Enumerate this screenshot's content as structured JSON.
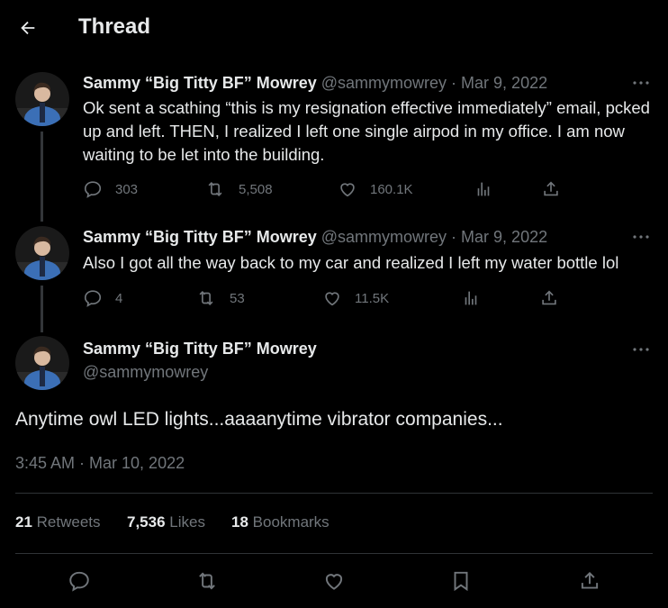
{
  "header": {
    "title": "Thread",
    "back_icon": "back-arrow-icon"
  },
  "tweets": [
    {
      "name": "Sammy “Big Titty BF” Mowrey",
      "handle": "@sammymowrey",
      "separator": "·",
      "date": "Mar 9, 2022",
      "text": "Ok sent a scathing “this is my resignation effective immediately” email, pcked up and left. THEN, I realized I left one single airpod in my office. I am now waiting to be let into the building.",
      "replies": "303",
      "retweets": "5,508",
      "likes": "160.1K"
    },
    {
      "name": "Sammy “Big Titty BF” Mowrey",
      "handle": "@sammymowrey",
      "separator": "·",
      "date": "Mar 9, 2022",
      "text": "Also I got all the way back to my car and realized I left my water bottle lol",
      "replies": "4",
      "retweets": "53",
      "likes": "11.5K"
    }
  ],
  "main_tweet": {
    "name": "Sammy “Big Titty BF” Mowrey",
    "handle": "@sammymowrey",
    "text": "Anytime owl LED lights...aaaanytime vibrator companies...",
    "timestamp": "3:45 AM · Mar 10, 2022",
    "stats": {
      "retweets_count": "21",
      "retweets_label": "Retweets",
      "likes_count": "7,536",
      "likes_label": "Likes",
      "bookmarks_count": "18",
      "bookmarks_label": "Bookmarks"
    }
  },
  "colors": {
    "background": "#000000",
    "text_primary": "#e7e9ea",
    "text_secondary": "#71767b",
    "divider": "#2f3336",
    "avatar_shirt": "#3b6fb6"
  }
}
